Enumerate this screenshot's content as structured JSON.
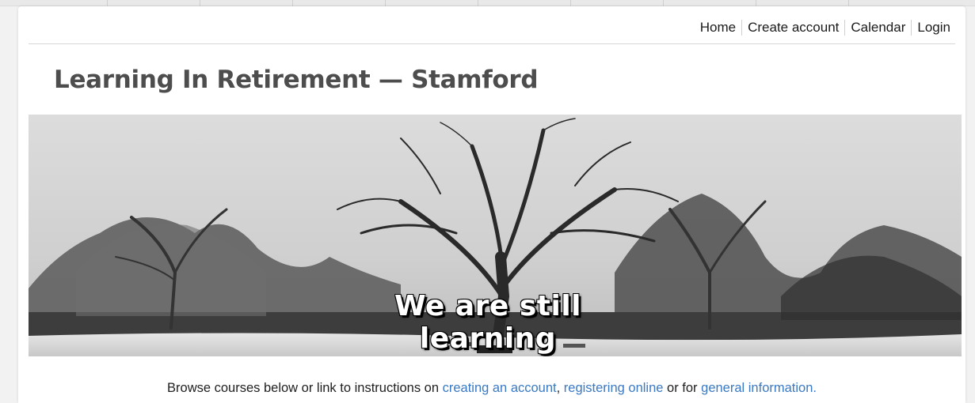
{
  "nav": {
    "items": [
      {
        "label": "Home"
      },
      {
        "label": "Create account"
      },
      {
        "label": "Calendar"
      },
      {
        "label": "Login"
      }
    ]
  },
  "site": {
    "title": "Learning In Retirement — Stamford"
  },
  "banner": {
    "overlay_text": "We are still learning",
    "image": "snowy-park-tree-photo"
  },
  "intro": {
    "prefix": "Browse courses below or link to instructions on ",
    "link_create": "creating an account",
    "comma": ", ",
    "link_register": "registering online",
    "middle": " or for ",
    "link_info": "general information."
  },
  "colors": {
    "link": "#3a79c4",
    "title": "#4d4d4d"
  }
}
